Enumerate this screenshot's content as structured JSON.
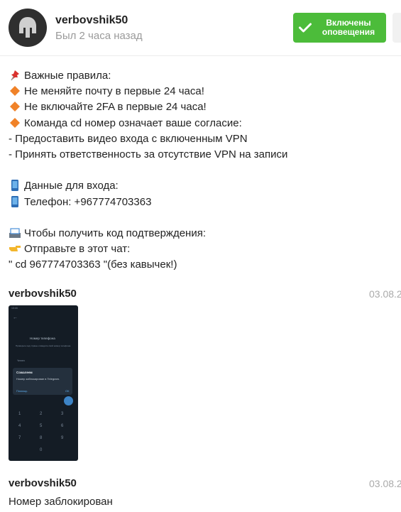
{
  "header": {
    "username": "verbovshik50",
    "last_seen": "Был 2 часа назад",
    "notify_button": "Включены оповещения"
  },
  "message1": {
    "lines": [
      {
        "icon": "pushpin-icon",
        "text": "Важные правила:"
      },
      {
        "icon": "orange-diamond-icon",
        "text": "Не меняйте почту в первые 24 часа!"
      },
      {
        "icon": "orange-diamond-icon",
        "text": "Не включайте 2FA в первые 24 часа!"
      },
      {
        "icon": "orange-diamond-icon",
        "text": "Команда cd номер означает ваше согласие:"
      },
      {
        "icon": null,
        "text": "- Предоставить видео входа с включенным VPN"
      },
      {
        "icon": null,
        "text": "- Принять ответственность за отсутствие VPN на записи"
      },
      {
        "blank": true
      },
      {
        "icon": "mobile-phone-icon",
        "text": "Данные для входа:"
      },
      {
        "icon": "mobile-phone-icon",
        "text": "Телефон: +967774703363"
      },
      {
        "blank": true
      },
      {
        "icon": "inbox-tray-icon",
        "text": "Чтобы получить код подтверждения:"
      },
      {
        "icon": "pointing-hand-icon",
        "text": "Отправьте в этот чат:"
      },
      {
        "icon": null,
        "text": "\" cd 967774703363 \"(без кавычек!)"
      }
    ]
  },
  "post1": {
    "author": "verbovshik50",
    "date": "03.08.2",
    "screenshot": {
      "status_time": "13:44",
      "heading": "Номер телефона",
      "hint": "Проверьте код страны и введите свой номер телефона.",
      "country": "Yemen",
      "dialog_title": "Сожалеем",
      "dialog_body": "Номер заблокирован в Telegram.",
      "dialog_link": "Помощь",
      "dialog_ok": "ОК",
      "keypad": [
        "1",
        "2",
        "3",
        "4",
        "5",
        "6",
        "7",
        "8",
        "9",
        "0"
      ]
    }
  },
  "post2": {
    "author": "verbovshik50",
    "date": "03.08.2",
    "text": "Номер заблокирован"
  }
}
